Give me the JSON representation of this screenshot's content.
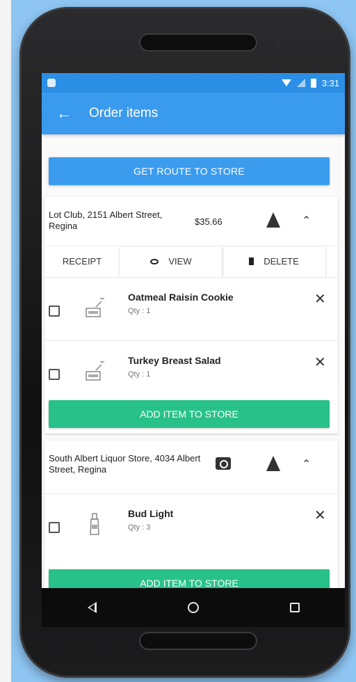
{
  "status_bar": {
    "time": "3:31"
  },
  "app_bar": {
    "back_icon": "arrow-left-icon",
    "title": "Order items"
  },
  "route_button": {
    "label": "GET ROUTE TO STORE"
  },
  "stores": [
    {
      "name": "Lot Club, 2151 Albert Street, Regina",
      "price": "$35.66",
      "actions": {
        "receipt": "RECEIPT",
        "view": "VIEW",
        "delete": "DELETE"
      },
      "items": [
        {
          "name": "Oatmeal Raisin Cookie",
          "qty": "Qty :  1"
        },
        {
          "name": "Turkey Breast Salad",
          "qty": "Qty :  1"
        }
      ],
      "add_label": "ADD ITEM TO STORE"
    },
    {
      "name": "South Albert Liquor Store, 4034 Albert Street, Regina",
      "items": [
        {
          "name": "Bud Light",
          "qty": "Qty :  3"
        }
      ],
      "add_label": "ADD ITEM TO STORE"
    }
  ],
  "icons": {
    "back": "arrow-left-icon",
    "navigate": "navigation-arrow-icon",
    "collapse": "chevron-up-icon",
    "view": "eye-icon",
    "delete": "trash-icon",
    "remove": "close-icon",
    "camera": "camera-icon",
    "nav_back": "triangle-back-icon",
    "nav_home": "circle-home-icon",
    "nav_recents": "square-recents-icon"
  },
  "colors": {
    "app_bar": "#3a9aee",
    "status_bar": "#2c8fe6",
    "add_button": "#29c18a",
    "route_button": "#3b9cee"
  }
}
